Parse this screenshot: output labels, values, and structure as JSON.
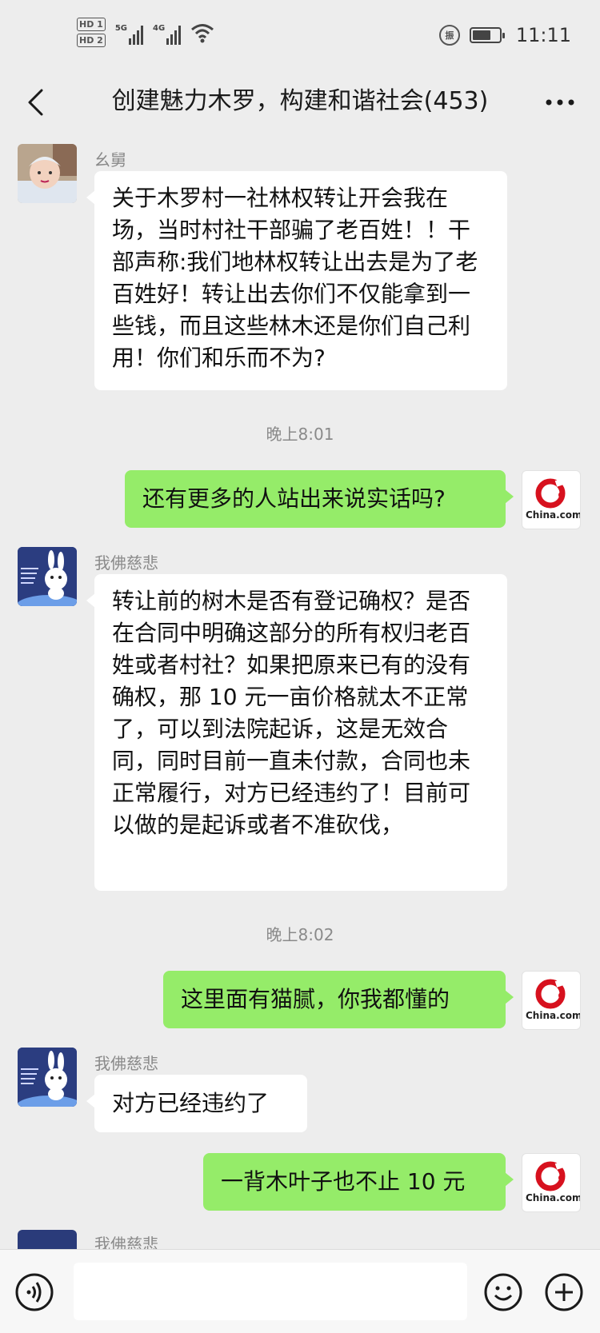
{
  "status_bar": {
    "hd1": "HD 1",
    "hd2": "HD 2",
    "net1": "5G",
    "net2": "4G",
    "vibrate_badge": "振",
    "time": "11:11"
  },
  "header": {
    "title": "创建魅力木罗，构建和谐社会(453)"
  },
  "messages": {
    "m1": {
      "sender": "幺舅",
      "text": "关于木罗村一社林权转让开会我在场，当时村社干部骗了老百姓！！干部声称:我们地林权转让出去是为了老百姓好！转让出去你们不仅能拿到一些钱，而且这些林木还是你们自己利用！你们和乐而不为?"
    },
    "t1": "晚上8:01",
    "m2": {
      "text": "还有更多的人站出来说实话吗?",
      "avatar_label": "China.com"
    },
    "m3": {
      "sender": "我佛慈悲",
      "text": "转让前的树木是否有登记确权？是否在合同中明确这部分的所有权归老百姓或者村社？如果把原来已有的没有确权，那 10 元一亩价格就太不正常了，可以到法院起诉，这是无效合同，同时目前一直未付款，合同也未正常履行，对方已经违约了！目前可以做的是起诉或者不准砍伐，"
    },
    "t2": "晚上8:02",
    "m4": {
      "text": "这里面有猫腻，你我都懂的",
      "avatar_label": "China.com"
    },
    "m5": {
      "sender": "我佛慈悲",
      "text": "对方已经违约了"
    },
    "m6": {
      "text": "一背木叶子也不止 10 元",
      "avatar_label": "China.com"
    },
    "m7": {
      "sender": "我佛慈悲"
    }
  },
  "colors": {
    "background": "#ededed",
    "bubble_self": "#95ec69",
    "bubble_other": "#ffffff",
    "china_logo_red": "#d7111e"
  },
  "icons": [
    "back-icon",
    "more-icon",
    "voice-icon",
    "emoji-icon",
    "plus-icon"
  ]
}
